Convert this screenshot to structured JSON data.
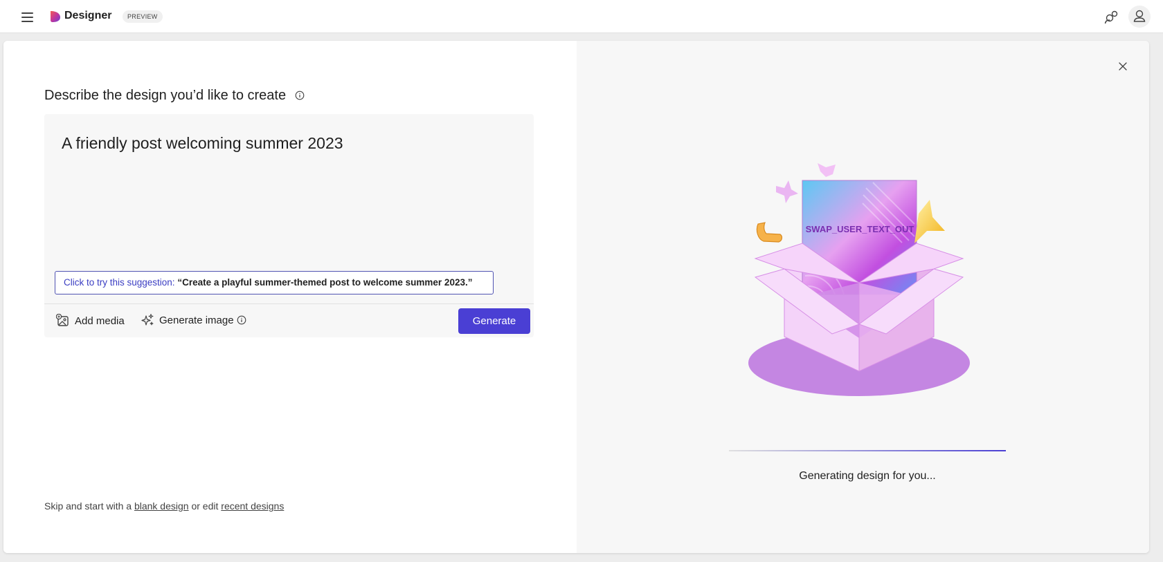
{
  "topbar": {
    "app_name": "Designer",
    "badge": "PREVIEW",
    "icons": {
      "menu": "hamburger-menu-icon",
      "logo": "designer-logo-icon",
      "share": "share-icon",
      "account": "person-icon"
    }
  },
  "prompt": {
    "title": "Describe the design you’d like to create",
    "text": "A friendly post welcoming summer 2023",
    "suggestion_lead": "Click to try this suggestion: ",
    "suggestion_quote": "“Create a playful summer-themed post to welcome summer 2023.”",
    "add_media_label": "Add media",
    "generate_image_label": "Generate image",
    "generate_button": "Generate"
  },
  "footer": {
    "prefix": "Skip and start with a ",
    "blank_link": "blank design",
    "middle": " or edit ",
    "recent_link": "recent designs"
  },
  "preview": {
    "card_text": "SWAP_USER_TEXT_OUT",
    "status": "Generating design for you...",
    "progress": 1.0
  },
  "colors": {
    "accent": "#4a3fd4",
    "suggestion_border": "#4f52b2",
    "box_pink": "#f3d1f7",
    "platform_purple": "#c47fe0"
  }
}
